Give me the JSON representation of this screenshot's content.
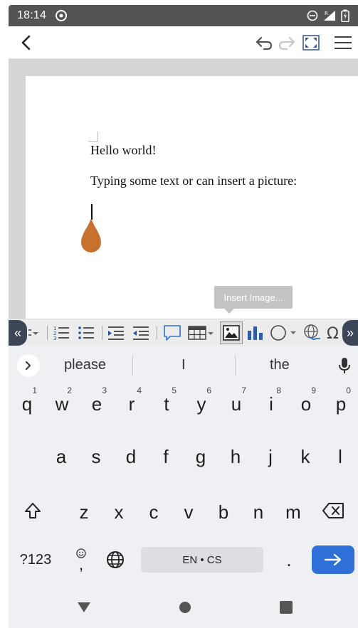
{
  "status_bar": {
    "time": "18:14"
  },
  "document": {
    "paragraphs": [
      "Hello world!",
      "Typing some text or can insert a picture:"
    ]
  },
  "tooltip": {
    "text": "Insert Image..."
  },
  "keyboard": {
    "suggestions": [
      "please",
      "I",
      "the"
    ],
    "rows": [
      [
        {
          "k": "q",
          "h": "1"
        },
        {
          "k": "w",
          "h": "2"
        },
        {
          "k": "e",
          "h": "3"
        },
        {
          "k": "r",
          "h": "4"
        },
        {
          "k": "t",
          "h": "5"
        },
        {
          "k": "y",
          "h": "6"
        },
        {
          "k": "u",
          "h": "7"
        },
        {
          "k": "i",
          "h": "8"
        },
        {
          "k": "o",
          "h": "9"
        },
        {
          "k": "p",
          "h": "0"
        }
      ],
      [
        {
          "k": "a"
        },
        {
          "k": "s"
        },
        {
          "k": "d"
        },
        {
          "k": "f"
        },
        {
          "k": "g"
        },
        {
          "k": "h"
        },
        {
          "k": "j"
        },
        {
          "k": "k"
        },
        {
          "k": "l"
        }
      ],
      [
        {
          "k": "z"
        },
        {
          "k": "x"
        },
        {
          "k": "c"
        },
        {
          "k": "v"
        },
        {
          "k": "b"
        },
        {
          "k": "n"
        },
        {
          "k": "m"
        }
      ]
    ],
    "symbols_label": "?123",
    "comma_label": ",",
    "space_label": "EN • CS",
    "period_label": "."
  },
  "colors": {
    "status_bar": "#545454",
    "accent_blue": "#2f6fd8",
    "toolbar_dark": "#3d4657",
    "cursor_handle": "#c9712e"
  }
}
